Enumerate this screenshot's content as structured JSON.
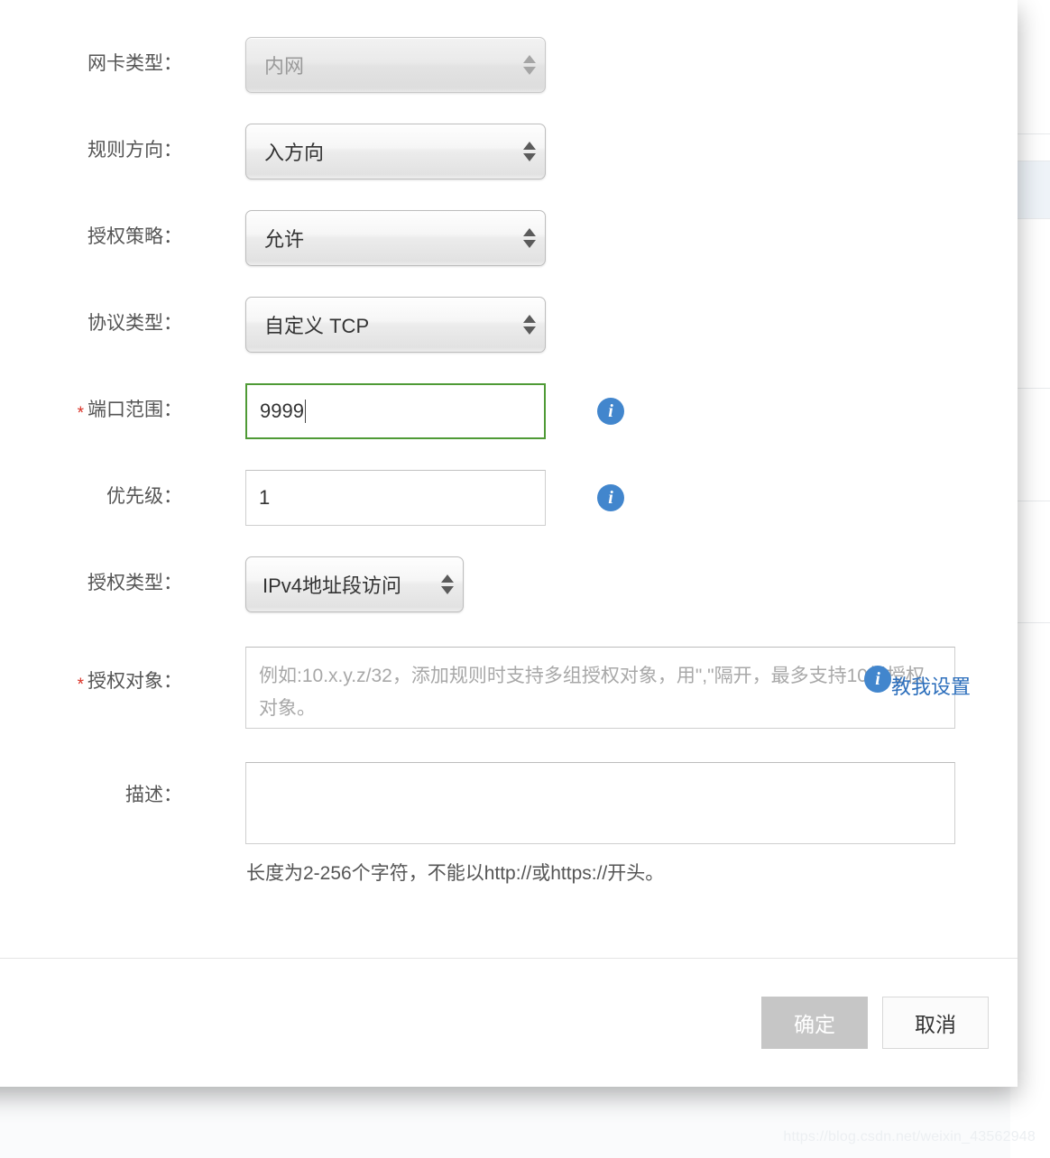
{
  "dialog": {
    "fields": {
      "nic_type": {
        "label": "网卡类型：",
        "required": false,
        "control": "select",
        "value": "内网",
        "disabled": true
      },
      "rule_direction": {
        "label": "规则方向：",
        "required": false,
        "control": "select",
        "value": "入方向",
        "disabled": false
      },
      "auth_policy": {
        "label": "授权策略：",
        "required": false,
        "control": "select",
        "value": "允许",
        "disabled": false
      },
      "protocol_type": {
        "label": "协议类型：",
        "required": false,
        "control": "select",
        "value": "自定义 TCP",
        "disabled": false
      },
      "port_range": {
        "label": "端口范围：",
        "required": true,
        "required_mark": "*",
        "control": "input",
        "value": "9999",
        "focused": true,
        "info_icon": "info-icon"
      },
      "priority": {
        "label": "优先级：",
        "required": false,
        "control": "input",
        "value": "1",
        "focused": false,
        "info_icon": "info-icon"
      },
      "auth_type": {
        "label": "授权类型：",
        "required": false,
        "control": "select",
        "value": "IPv4地址段访问",
        "disabled": false
      },
      "auth_object": {
        "label": "授权对象：",
        "required": true,
        "required_mark": "*",
        "control": "textarea",
        "value": "",
        "placeholder": "例如:10.x.y.z/32，添加规则时支持多组授权对象，用\",\"隔开，最多支持10组授权对象。",
        "info_icon": "info-icon",
        "help_link": "教我设置"
      },
      "description": {
        "label": "描述：",
        "required": false,
        "control": "textarea",
        "value": "",
        "placeholder": "",
        "hint": "长度为2-256个字符，不能以http://或https://开头。"
      }
    },
    "footer": {
      "confirm_label": "确定",
      "confirm_disabled": true,
      "cancel_label": "取消"
    }
  },
  "watermark": "https://blog.csdn.net/weixin_43562948",
  "colors": {
    "focus_border": "#4f9a36",
    "required_star": "#d93025",
    "info_badge": "#4286cd",
    "link": "#2d6fbc",
    "disabled_button": "#c6c6c6"
  }
}
